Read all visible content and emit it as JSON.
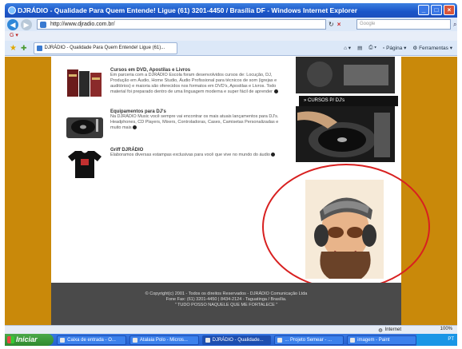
{
  "window": {
    "title": "DJRÁDIO - Qualidade Para Quem Entende! Ligue (61) 3201-4450 / Brasília DF - Windows Internet Explorer"
  },
  "address_bar": {
    "url": "http://www.djradio.com.br/",
    "search_placeholder": "Google"
  },
  "tab": {
    "label": "DJRÁDIO - Qualidade Para Quem Entende! Ligue (61)..."
  },
  "command_bar": {
    "page_label": "Página",
    "tools_label": "Ferramentas"
  },
  "products": [
    {
      "title": "Cursos em DVD, Apostilas e Livros",
      "desc": "Em parceria com a DJRÁDIO Escola foram desenvolvidos cursos de: Locução, DJ, Produção em Áudio, Home Studio, Áudio Profissional para técnicos de som (igrejas e auditórios) e maioria são oferecidos nos formatos em DVD's, Apostilas e Livros. Todo material foi preparado dentro de uma linguagem moderna e super fácil de aprender"
    },
    {
      "title": "Equipamentos para DJ's",
      "desc": "Na DJRÁDIO Music você sempre vai encontrar os mais atuais lançamentos para DJ's. Headphones, CD Players, Mixers, Controladoras, Cases, Camisetas Personalizadas e muito mais"
    },
    {
      "title": "Griff DJRÁDIO",
      "desc": "Elaboramos diversas estampas exclusivas para você que vive no mundo do áudio"
    }
  ],
  "sidebar": {
    "cursos_label": "» CURSOS P/ DJ's"
  },
  "footer": {
    "line1": "© Copyright(c) 2001 - Todos os direitos Reservados - DJRÁDIO Comunicação Ltda",
    "line2": "Fone Fax: (61) 3201-4450 | 8434-2124 - Taguatinga / Brasília.",
    "line3": "\" TUDO POSSO NAQUELE QUE ME FORTALECE \""
  },
  "statusbar": {
    "zone": "Internet",
    "zoom": "100%"
  },
  "taskbar": {
    "start": "Iniciar",
    "tasks": [
      "Caixa de entrada - O...",
      "Atalaia Polo - Micros...",
      "DJRÁDIO - Qualidade...",
      "... Projeto Semear - ...",
      "imagem - Paint"
    ],
    "tray": "PT"
  },
  "colors": {
    "page_background": "#c9890a",
    "annotation_circle": "#d82020"
  }
}
